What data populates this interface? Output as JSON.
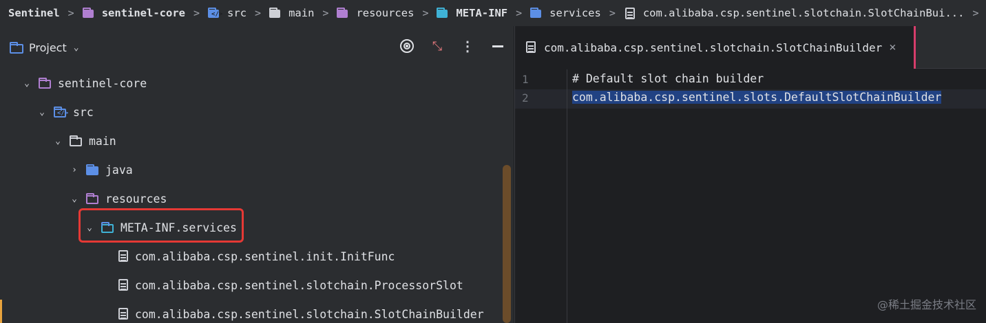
{
  "breadcrumbs": [
    {
      "label": "Sentinel",
      "icon": "none"
    },
    {
      "label": "sentinel-core",
      "icon": "module-folder-icon"
    },
    {
      "label": "src",
      "icon": "source-folder-icon"
    },
    {
      "label": "main",
      "icon": "folder-icon"
    },
    {
      "label": "resources",
      "icon": "resources-folder-icon"
    },
    {
      "label": "META-INF",
      "icon": "meta-inf-folder-icon"
    },
    {
      "label": "services",
      "icon": "services-folder-icon"
    },
    {
      "label": "com.alibaba.csp.sentinel.slotchain.SlotChainBui...",
      "icon": "file-icon"
    }
  ],
  "project": {
    "title": "Project",
    "tree": [
      {
        "label": "sentinel-core",
        "expanded": true
      },
      {
        "label": "src",
        "expanded": true
      },
      {
        "label": "main",
        "expanded": true
      },
      {
        "label": "java",
        "expanded": false
      },
      {
        "label": "resources",
        "expanded": true
      },
      {
        "label": "META-INF.services",
        "expanded": true
      },
      {
        "label": "com.alibaba.csp.sentinel.init.InitFunc"
      },
      {
        "label": "com.alibaba.csp.sentinel.slotchain.ProcessorSlot"
      },
      {
        "label": "com.alibaba.csp.sentinel.slotchain.SlotChainBuilder"
      }
    ]
  },
  "editor": {
    "tab_label": "com.alibaba.csp.sentinel.slotchain.SlotChainBuilder",
    "lines": [
      {
        "num": "1",
        "text": "# Default slot chain builder"
      },
      {
        "num": "2",
        "text": "com.alibaba.csp.sentinel.slots.DefaultSlotChainBuilder"
      }
    ]
  },
  "watermark": "@稀土掘金技术社区",
  "colors": {
    "accent_red": "#e53935",
    "selection": "#214283",
    "tab_marker": "#d63d6b"
  }
}
